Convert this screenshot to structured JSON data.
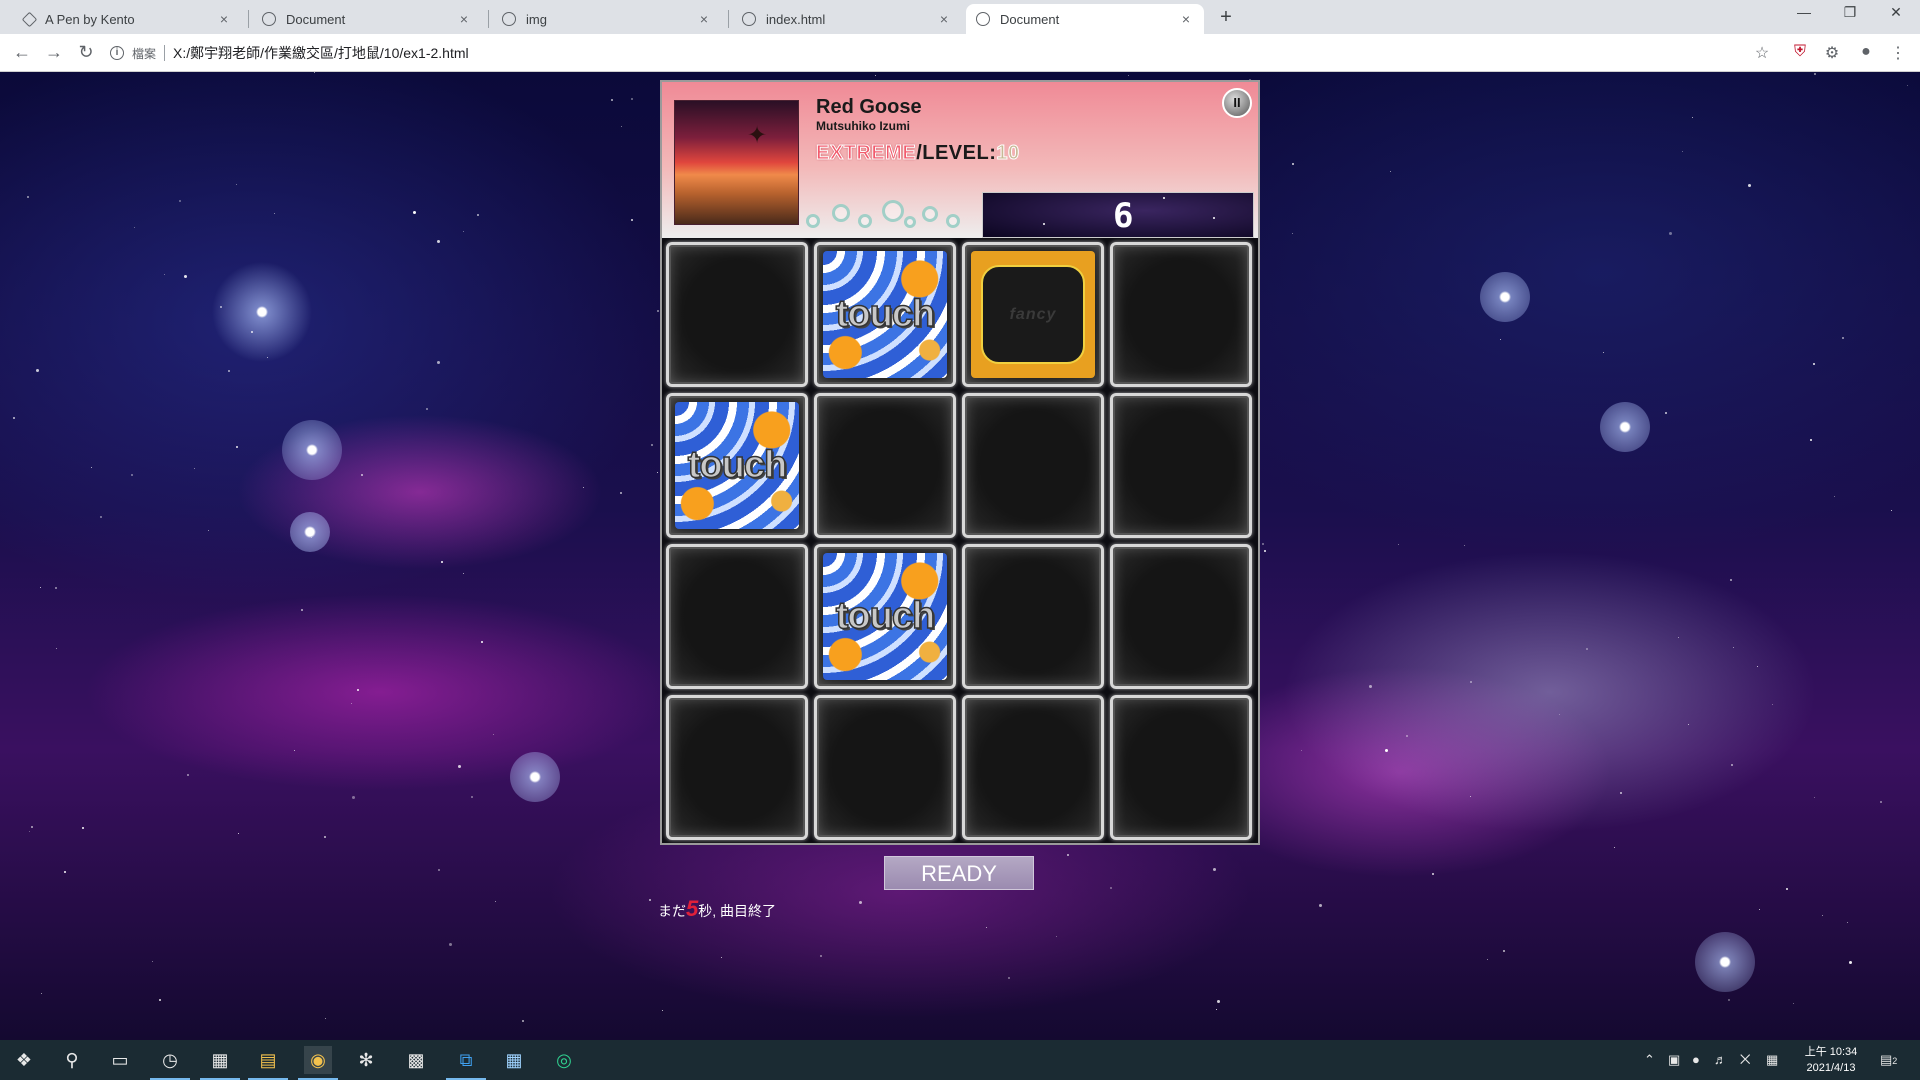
{
  "browser": {
    "tabs": [
      {
        "label": "A Pen by Kento",
        "icon": "codepen-icon",
        "active": false
      },
      {
        "label": "Document",
        "icon": "globe-icon",
        "active": false
      },
      {
        "label": "img",
        "icon": "globe-icon",
        "active": false
      },
      {
        "label": "index.html",
        "icon": "globe-icon",
        "active": false
      },
      {
        "label": "Document",
        "icon": "globe-icon",
        "active": true
      }
    ],
    "tab_close": "×",
    "new_tab": "+",
    "address": {
      "file_label": "檔案",
      "url": "X:/鄭宇翔老師/作業繳交區/打地鼠/10/ex1-2.html"
    }
  },
  "game": {
    "song": {
      "title": "Red Goose",
      "artist": "Mutsuhiko Izumi",
      "difficulty": "EXTREME",
      "level_separator": "/",
      "level_label": "LEVEL:",
      "level_value": "10"
    },
    "pause_label": "II",
    "score": "6",
    "grid": [
      [
        "empty",
        "touch",
        "fancy",
        "empty"
      ],
      [
        "touch",
        "empty",
        "empty",
        "empty"
      ],
      [
        "empty",
        "touch",
        "empty",
        "empty"
      ],
      [
        "empty",
        "empty",
        "empty",
        "empty"
      ]
    ],
    "tile_text": {
      "touch": "touch",
      "fancy": "fancy"
    },
    "ready_label": "READY",
    "countdown": {
      "prefix": "まだ",
      "seconds": "5",
      "suffix": "秒, 曲目終了"
    }
  },
  "taskbar": {
    "clock_time": "上午 10:34",
    "clock_date": "2021/4/13",
    "notification_count": "2"
  },
  "colors": {
    "accent_taskbar": "#1b2b33",
    "difficulty_color": "#f25a6c",
    "countdown_color": "#e0203a"
  }
}
